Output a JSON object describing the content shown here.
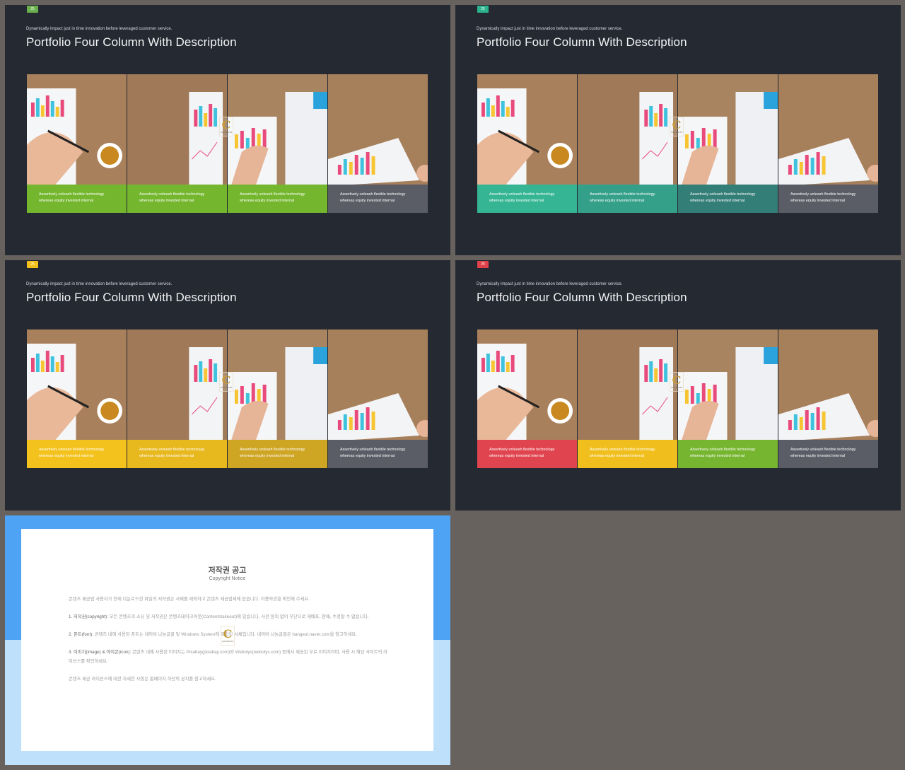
{
  "slides": [
    {
      "page": "25",
      "page_color": "#6ab04c",
      "subtitle": "Dynamically impact just in time innovation  before leveraged customer service.",
      "title": "Portfolio Four Column With Description",
      "captions": [
        {
          "l1": "Assertively unleash flexible technology",
          "l2": "whereas equity invested internal",
          "color": "#74b62e"
        },
        {
          "l1": "Assertively unleash flexible technology",
          "l2": "whereas equity invested internal",
          "color": "#74b62e"
        },
        {
          "l1": "Assertively unleash flexible technology",
          "l2": "whereas equity invested internal",
          "color": "#74b62e"
        },
        {
          "l1": "Assertively unleash flexible technology",
          "l2": "whereas equity invested internal",
          "color": "#5a5d66"
        }
      ]
    },
    {
      "page": "25",
      "page_color": "#2bb38d",
      "subtitle": "Dynamically impact just in time innovation  before leveraged customer service.",
      "title": "Portfolio Four Column With Description",
      "captions": [
        {
          "l1": "Assertively unleash flexible technology",
          "l2": "whereas equity invested internal",
          "color": "#35b594"
        },
        {
          "l1": "Assertively unleash flexible technology",
          "l2": "whereas equity invested internal",
          "color": "#35a08a"
        },
        {
          "l1": "Assertively unleash flexible technology",
          "l2": "whereas equity invested internal",
          "color": "#347e78"
        },
        {
          "l1": "Assertively unleash flexible technology",
          "l2": "whereas equity invested internal",
          "color": "#5a5d66"
        }
      ]
    },
    {
      "page": "25",
      "page_color": "#f2c21b",
      "subtitle": "Dynamically impact just in time innovation  before leveraged customer service.",
      "title": "Portfolio Four Column With Description",
      "captions": [
        {
          "l1": "Assertively unleash flexible technology",
          "l2": "whereas equity invested internal",
          "color": "#f3c21c"
        },
        {
          "l1": "Assertively unleash flexible technology",
          "l2": "whereas equity invested internal",
          "color": "#e8b81f"
        },
        {
          "l1": "Assertively unleash flexible technology",
          "l2": "whereas equity invested internal",
          "color": "#cfa524"
        },
        {
          "l1": "Assertively unleash flexible technology",
          "l2": "whereas equity invested internal",
          "color": "#5a5d66"
        }
      ]
    },
    {
      "page": "25",
      "page_color": "#e0414a",
      "subtitle": "Dynamically impact just in time innovation  before leveraged customer service.",
      "title": "Portfolio Four Column With Description",
      "captions": [
        {
          "l1": "Assertively unleash flexible technology",
          "l2": "whereas equity invested internal",
          "color": "#e0444f"
        },
        {
          "l1": "Assertively unleash flexible technology",
          "l2": "whereas equity invested internal",
          "color": "#f0bf1e"
        },
        {
          "l1": "Assertively unleash flexible technology",
          "l2": "whereas equity invested internal",
          "color": "#76b52f"
        },
        {
          "l1": "Assertively unleash flexible technology",
          "l2": "whereas equity invested internal",
          "color": "#5a5d66"
        }
      ]
    }
  ],
  "copyright": {
    "title": "저작권 공고",
    "subtitle": "Copyright Notice",
    "intro": "콘텐츠 제공업 사용자가 현재 다운로드한 파일의 저작권은 서체를 제외하고 콘텐츠 제공업체에 있습니다. 이용약관을 확인해 주세요.",
    "p1_head": "1. 저작권(copyright):",
    "p1_body": "모든 콘텐츠의 소유 및 저작권은 콘텐츠테이크아웃(Contentstakeout)에 있습니다. 사전 동의 없이 무단으로 재배포, 판매, 수정할 수 없습니다.",
    "p2_head": "2. 폰트(font):",
    "p2_body": "콘텐츠 내에 사용된 폰트는 네이버 나눔글꼴 및 Windows System에 포함된 서체입니다. 네이버 나눔글꼴은 hangeul.naver.com을 참고하세요.",
    "p3_head": "3. 이미지(image) & 아이콘(icon):",
    "p3_body": "콘텐츠 내에 사용된 이미지는 Pixabay(pixabay.com)와 Webolys(webolys.com) 등에서 제공된 무료 이미지이며, 사용 시 해당 사이트의 라이선스를 확인하세요.",
    "outro": "콘텐츠 제공 라이선스에 대한 자세한 사항은 홈페이지 하단의 공지를 참고하세요."
  }
}
